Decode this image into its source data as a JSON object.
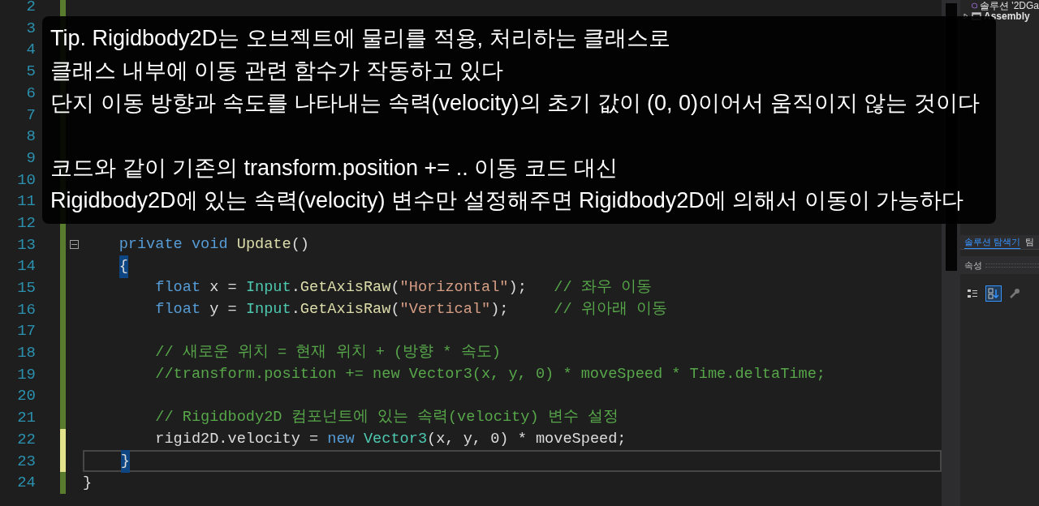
{
  "editor": {
    "lines": [
      {
        "number": "2",
        "unsaved": false
      },
      {
        "number": "3",
        "unsaved": false
      },
      {
        "number": "4",
        "unsaved": false
      },
      {
        "number": "5",
        "unsaved": false
      },
      {
        "number": "6",
        "unsaved": false
      },
      {
        "number": "7",
        "unsaved": false
      },
      {
        "number": "8",
        "unsaved": false
      },
      {
        "number": "9",
        "unsaved": false
      },
      {
        "number": "10",
        "unsaved": false
      },
      {
        "number": "11",
        "unsaved": false
      },
      {
        "number": "12",
        "unsaved": false
      },
      {
        "number": "13",
        "unsaved": false,
        "fold": true,
        "tokens": [
          {
            "kind": "keyword",
            "text": "    private void"
          },
          {
            "kind": "method",
            "text": " Update"
          },
          {
            "kind": "plain",
            "text": "()"
          }
        ]
      },
      {
        "number": "14",
        "unsaved": false,
        "tokens": [
          {
            "kind": "brace_match",
            "text": "    {"
          }
        ]
      },
      {
        "number": "15",
        "unsaved": false,
        "tokens": [
          {
            "kind": "keyword",
            "text": "        float"
          },
          {
            "kind": "plain",
            "text": " x = "
          },
          {
            "kind": "type",
            "text": "Input"
          },
          {
            "kind": "plain",
            "text": "."
          },
          {
            "kind": "method",
            "text": "GetAxisRaw"
          },
          {
            "kind": "plain",
            "text": "("
          },
          {
            "kind": "string",
            "text": "\"Horizontal\""
          },
          {
            "kind": "plain",
            "text": ");"
          },
          {
            "kind": "comment",
            "text": "   // 좌우 이동"
          }
        ]
      },
      {
        "number": "16",
        "unsaved": false,
        "tokens": [
          {
            "kind": "keyword",
            "text": "        float"
          },
          {
            "kind": "plain",
            "text": " y = "
          },
          {
            "kind": "type",
            "text": "Input"
          },
          {
            "kind": "plain",
            "text": "."
          },
          {
            "kind": "method",
            "text": "GetAxisRaw"
          },
          {
            "kind": "plain",
            "text": "("
          },
          {
            "kind": "string",
            "text": "\"Vertical\""
          },
          {
            "kind": "plain",
            "text": ");"
          },
          {
            "kind": "comment",
            "text": "     // 위아래 이동"
          }
        ]
      },
      {
        "number": "17",
        "unsaved": false
      },
      {
        "number": "18",
        "unsaved": false,
        "tokens": [
          {
            "kind": "comment",
            "text": "        // 새로운 위치 = 현재 위치 + (방향 * 속도)"
          }
        ]
      },
      {
        "number": "19",
        "unsaved": false,
        "tokens": [
          {
            "kind": "comment",
            "text": "        //transform.position += new Vector3(x, y, 0) * moveSpeed * Time.deltaTime;"
          }
        ]
      },
      {
        "number": "20",
        "unsaved": false
      },
      {
        "number": "21",
        "unsaved": false,
        "tokens": [
          {
            "kind": "comment",
            "text": "        // Rigidbody2D 컴포넌트에 있는 속력(velocity) 변수 설정"
          }
        ]
      },
      {
        "number": "22",
        "unsaved": true,
        "tokens": [
          {
            "kind": "plain",
            "text": "        rigid2D.velocity = "
          },
          {
            "kind": "keyword",
            "text": "new"
          },
          {
            "kind": "type",
            "text": " Vector3"
          },
          {
            "kind": "plain",
            "text": "(x, y, 0) * moveSpeed;"
          }
        ]
      },
      {
        "number": "23",
        "unsaved": true,
        "current": true,
        "tokens": [
          {
            "kind": "brace_match",
            "text": "    }"
          }
        ]
      },
      {
        "number": "24",
        "unsaved": false,
        "tokens": [
          {
            "kind": "plain",
            "text": "}"
          }
        ]
      }
    ]
  },
  "caption": {
    "paragraphs": [
      [
        "Tip. Rigidbody2D는 오브젝트에 물리를 적용, 처리하는 클래스로",
        "클래스 내부에 이동 관련 함수가 작동하고 있다",
        "단지 이동 방향과 속도를 나타내는 속력(velocity)의 초기 값이 (0, 0)이어서 움직이지 않는 것이다"
      ],
      [
        "코드와 같이 기존의 transform.position += .. 이동 코드 대신",
        "Rigidbody2D에 있는 속력(velocity) 변수만 설정해주면 Rigidbody2D에 의해서 이동이 가능하다"
      ]
    ]
  },
  "side_panel": {
    "tree": [
      {
        "kind": "solution",
        "label": "솔루션 '2DGa"
      },
      {
        "kind": "project",
        "label": "Assembly"
      }
    ],
    "tabs": [
      {
        "label": "솔루션 탐색기",
        "selected": true
      },
      {
        "label": "팀",
        "selected": false
      }
    ],
    "properties_title": "속성",
    "toolbar": [
      {
        "kind": "categorized",
        "selected": false
      },
      {
        "kind": "alphabetical",
        "selected": true
      },
      {
        "kind": "property-pages",
        "selected": false
      }
    ]
  }
}
